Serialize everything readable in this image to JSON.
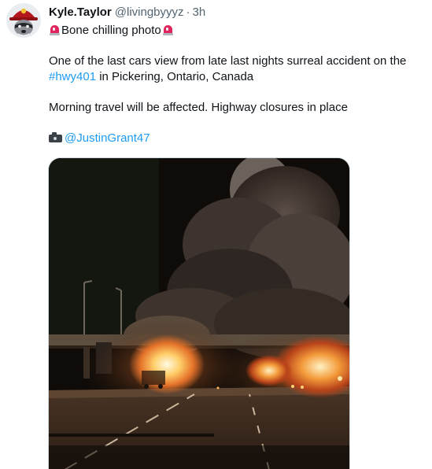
{
  "tweet": {
    "display_name": "Kyle.Taylor",
    "handle": "@livingbyyyz",
    "separator": "·",
    "time": "3h",
    "line1_text": "Bone chilling photo",
    "line2_text": "One of the last cars view from late last nights surreal accident on the",
    "hashtag": "#hwy401",
    "line3_text": " in  Pickering, Ontario, Canada",
    "line4_text": "Morning travel will be affected. Highway closures in place",
    "mention": "@JustinGrant47"
  },
  "icons": {
    "siren": "police-car-light-icon",
    "camera": "camera-icon",
    "avatar": "raccoon-firefighter-avatar"
  },
  "colors": {
    "link": "#1d9bf0",
    "text": "#0f1419",
    "muted": "#536471",
    "siren_red": "#e0245e"
  }
}
